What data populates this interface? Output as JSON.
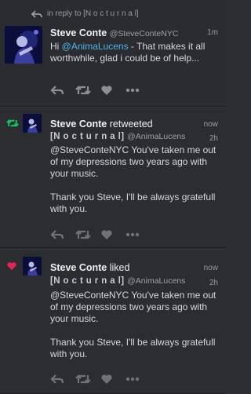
{
  "tweet1": {
    "reply_context": "in reply to [N o c t u r n a l]",
    "author": "Steve Conte",
    "handle": "@SteveConteNYC",
    "time": "1m",
    "text_before_mention": "Hi ",
    "mention": "@AnimaLucens",
    "text_after_mention": " - That makes it all worthwhile, glad i could be of help..."
  },
  "tweet2": {
    "actor": "Steve Conte",
    "verb": "retweeted",
    "time": "now",
    "quoted_author": "[N o c t u r n a l]",
    "quoted_handle": "@AnimaLucens",
    "quoted_time": "2h",
    "quoted_line1": "@SteveConteNYC You've taken me out of my depressions two years ago with your music.",
    "quoted_line2": "Thank you Steve, I'll be always gratefull with you."
  },
  "tweet3": {
    "actor": "Steve Conte",
    "verb": "liked",
    "time": "now",
    "quoted_author": "[N o c t u r n a l]",
    "quoted_handle": "@AnimaLucens",
    "quoted_time": "2h",
    "quoted_line1": "@SteveConteNYC You've taken me out of my depressions two years ago with your music.",
    "quoted_line2": "Thank you Steve, I'll be always gratefull with you."
  },
  "colors": {
    "background": "#2b2d31",
    "mention": "#4fb3e6",
    "retweet_green": "#17bf63",
    "like_red": "#e0245e",
    "icon_gray": "#8b8e93"
  }
}
